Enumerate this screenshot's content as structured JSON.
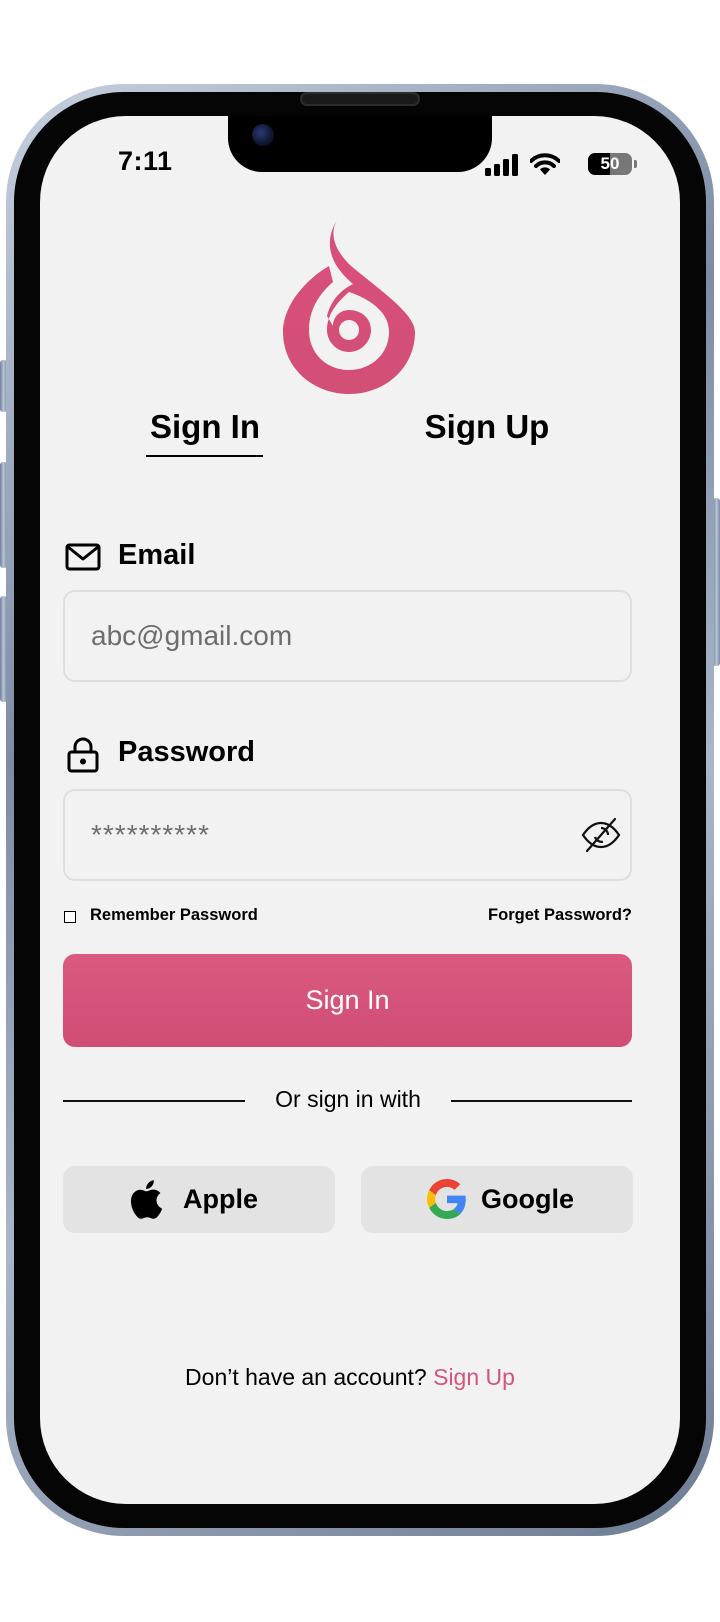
{
  "status_bar": {
    "time": "7:11",
    "battery_level": "50",
    "battery_fraction": 0.5,
    "icons": [
      "cellular-signal-icon",
      "wifi-icon",
      "battery-icon"
    ]
  },
  "brand": {
    "icon": "flame-drop-logo",
    "accent_color": "#d4557c"
  },
  "tabs": [
    {
      "label": "Sign In",
      "active": true
    },
    {
      "label": "Sign Up",
      "active": false
    }
  ],
  "email": {
    "label": "Email",
    "icon": "mail-icon",
    "placeholder": "abc@gmail.com"
  },
  "password": {
    "label": "Password",
    "icon": "lock-icon",
    "placeholder": "**********",
    "toggle_icon": "eye-off-icon"
  },
  "options": {
    "remember_label": "Remember Password",
    "remember_checked": false,
    "forget_label": "Forget Password?"
  },
  "primary_button": {
    "label": "Sign In"
  },
  "divider": {
    "label": "Or sign in with"
  },
  "social": [
    {
      "label": "Apple",
      "icon": "apple-icon"
    },
    {
      "label": "Google",
      "icon": "google-icon"
    }
  ],
  "footer": {
    "prompt": "Don’t have an account?",
    "link": "Sign Up"
  }
}
